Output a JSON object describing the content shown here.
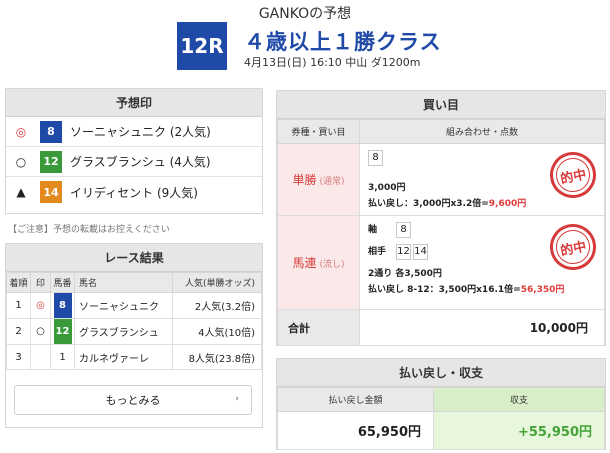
{
  "header": {
    "title": "GANKOの予想",
    "race_no": "12R",
    "race_name": "４歳以上１勝クラス",
    "race_info": "4月13日(日) 16:10 中山 ダ1200m"
  },
  "yosou": {
    "heading": "予想印",
    "rows": [
      {
        "mark": "◎",
        "bib": "8",
        "name": "ソーニャシュニク (2人気)"
      },
      {
        "mark": "○",
        "bib": "12",
        "name": "グラスブランシュ (4人気)"
      },
      {
        "mark": "▲",
        "bib": "14",
        "name": "イリディセント (9人気)"
      }
    ],
    "note": "【ご注意】予想の転載はお控えください"
  },
  "result": {
    "heading": "レース結果",
    "columns": [
      "着順",
      "印",
      "馬番",
      "馬名",
      "人気(単勝オッズ)"
    ],
    "rows": [
      {
        "pos": "1",
        "mark": "◎",
        "bib": "8",
        "name": "ソーニャシュニク",
        "pop": "2人気(3.2倍)"
      },
      {
        "pos": "2",
        "mark": "○",
        "bib": "12",
        "name": "グラスブランシュ",
        "pop": "4人気(10倍)"
      },
      {
        "pos": "3",
        "mark": "",
        "bib": "1",
        "name": "カルネヴァーレ",
        "pop": "8人気(23.8倍)"
      }
    ],
    "more_label": "もっとみる",
    "more_arrow": "›"
  },
  "kaime": {
    "heading": "買い目",
    "col_type": "券種・買い目",
    "col_combo": "組み合わせ・点数",
    "bets": [
      {
        "type": "単勝",
        "sub": "(通常)",
        "numbers": [
          "8"
        ],
        "amount": "3,000円",
        "pay_prefix": "払い戻し：3,000円x3.2倍=",
        "pay_value": "9,600円",
        "stamp": "的中"
      },
      {
        "type": "馬連",
        "sub": "(流し)",
        "axis_label": "軸",
        "axis": [
          "8"
        ],
        "partner_label": "相手",
        "partners": [
          "12",
          "14"
        ],
        "amount": "2通り 各3,500円",
        "pay_prefix": "払い戻し 8-12：3,500円x16.1倍=",
        "pay_value": "56,350円",
        "stamp": "的中"
      }
    ],
    "total_label": "合計",
    "total_value": "10,000円"
  },
  "summary": {
    "heading": "払い戻し・収支",
    "col_payout": "払い戻し金額",
    "col_balance": "収支",
    "payout": "65,950円",
    "balance": "+55,950円"
  },
  "colors": {
    "accent_blue": "#1f4aa8",
    "hit_red": "#d63a3a",
    "gain_green": "#43a335"
  }
}
